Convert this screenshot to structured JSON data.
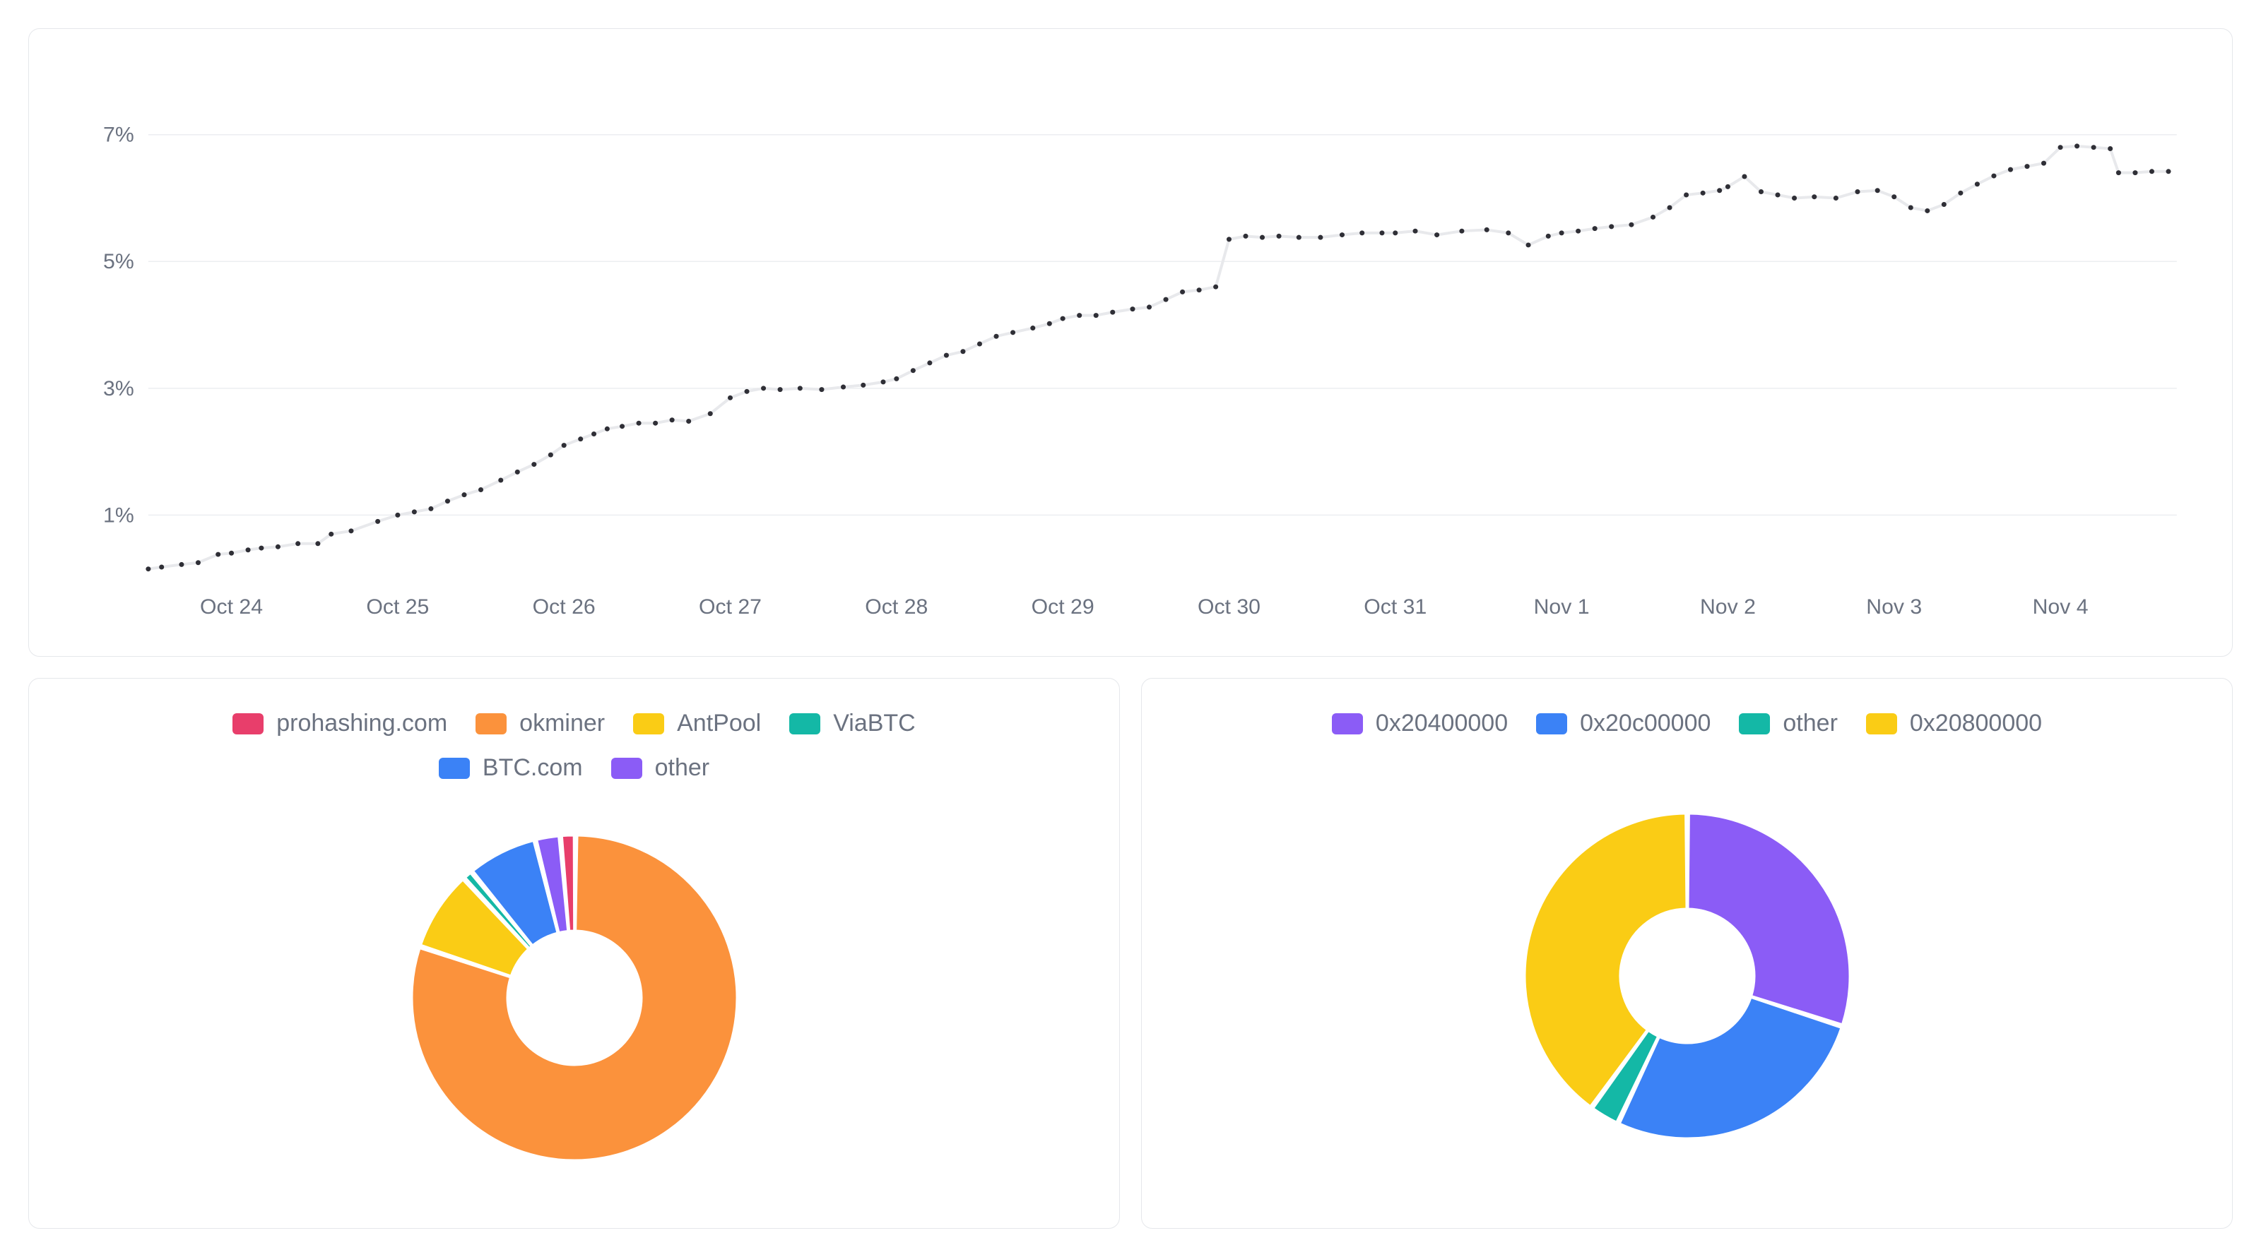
{
  "chart_data": [
    {
      "type": "line",
      "title": "",
      "xlabel": "",
      "ylabel": "",
      "ylim": [
        0,
        8
      ],
      "y_ticks": [
        1,
        3,
        5,
        7
      ],
      "y_tick_format": "%",
      "x_categories": [
        "Oct 24",
        "Oct 25",
        "Oct 26",
        "Oct 27",
        "Oct 28",
        "Oct 29",
        "Oct 30",
        "Oct 31",
        "Nov 1",
        "Nov 2",
        "Nov 3",
        "Nov 4"
      ],
      "series": [
        {
          "name": "value",
          "points": [
            [
              23.5,
              0.15
            ],
            [
              23.58,
              0.18
            ],
            [
              23.7,
              0.22
            ],
            [
              23.8,
              0.25
            ],
            [
              23.92,
              0.38
            ],
            [
              24.0,
              0.4
            ],
            [
              24.1,
              0.45
            ],
            [
              24.18,
              0.48
            ],
            [
              24.28,
              0.5
            ],
            [
              24.4,
              0.55
            ],
            [
              24.52,
              0.55
            ],
            [
              24.6,
              0.7
            ],
            [
              24.72,
              0.75
            ],
            [
              24.88,
              0.9
            ],
            [
              25.0,
              1.0
            ],
            [
              25.1,
              1.05
            ],
            [
              25.2,
              1.1
            ],
            [
              25.3,
              1.22
            ],
            [
              25.4,
              1.32
            ],
            [
              25.5,
              1.4
            ],
            [
              25.62,
              1.55
            ],
            [
              25.72,
              1.68
            ],
            [
              25.82,
              1.8
            ],
            [
              25.92,
              1.95
            ],
            [
              26.0,
              2.1
            ],
            [
              26.1,
              2.2
            ],
            [
              26.18,
              2.28
            ],
            [
              26.26,
              2.36
            ],
            [
              26.35,
              2.4
            ],
            [
              26.45,
              2.45
            ],
            [
              26.55,
              2.45
            ],
            [
              26.65,
              2.5
            ],
            [
              26.75,
              2.48
            ],
            [
              26.88,
              2.6
            ],
            [
              27.0,
              2.85
            ],
            [
              27.1,
              2.95
            ],
            [
              27.2,
              3.0
            ],
            [
              27.3,
              2.98
            ],
            [
              27.42,
              3.0
            ],
            [
              27.55,
              2.98
            ],
            [
              27.68,
              3.02
            ],
            [
              27.8,
              3.05
            ],
            [
              27.92,
              3.1
            ],
            [
              28.0,
              3.15
            ],
            [
              28.1,
              3.28
            ],
            [
              28.2,
              3.4
            ],
            [
              28.3,
              3.52
            ],
            [
              28.4,
              3.58
            ],
            [
              28.5,
              3.7
            ],
            [
              28.6,
              3.82
            ],
            [
              28.7,
              3.88
            ],
            [
              28.82,
              3.95
            ],
            [
              28.92,
              4.02
            ],
            [
              29.0,
              4.1
            ],
            [
              29.1,
              4.15
            ],
            [
              29.2,
              4.15
            ],
            [
              29.3,
              4.2
            ],
            [
              29.42,
              4.25
            ],
            [
              29.52,
              4.28
            ],
            [
              29.62,
              4.4
            ],
            [
              29.72,
              4.52
            ],
            [
              29.82,
              4.55
            ],
            [
              29.92,
              4.6
            ],
            [
              30.0,
              5.35
            ],
            [
              30.1,
              5.4
            ],
            [
              30.2,
              5.38
            ],
            [
              30.3,
              5.4
            ],
            [
              30.42,
              5.38
            ],
            [
              30.55,
              5.38
            ],
            [
              30.68,
              5.42
            ],
            [
              30.8,
              5.45
            ],
            [
              30.92,
              5.45
            ],
            [
              31.0,
              5.45
            ],
            [
              31.12,
              5.48
            ],
            [
              31.25,
              5.42
            ],
            [
              31.4,
              5.48
            ],
            [
              31.55,
              5.5
            ],
            [
              31.68,
              5.45
            ],
            [
              31.8,
              5.26
            ],
            [
              31.92,
              5.4
            ],
            [
              32.0,
              5.45
            ],
            [
              32.1,
              5.48
            ],
            [
              32.2,
              5.52
            ],
            [
              32.3,
              5.55
            ],
            [
              32.42,
              5.58
            ],
            [
              32.55,
              5.7
            ],
            [
              32.65,
              5.85
            ],
            [
              32.75,
              6.05
            ],
            [
              32.85,
              6.08
            ],
            [
              32.95,
              6.12
            ],
            [
              33.0,
              6.18
            ],
            [
              33.1,
              6.34
            ],
            [
              33.2,
              6.1
            ],
            [
              33.3,
              6.05
            ],
            [
              33.4,
              6.0
            ],
            [
              33.52,
              6.02
            ],
            [
              33.65,
              6.0
            ],
            [
              33.78,
              6.1
            ],
            [
              33.9,
              6.12
            ],
            [
              34.0,
              6.02
            ],
            [
              34.1,
              5.85
            ],
            [
              34.2,
              5.8
            ],
            [
              34.3,
              5.9
            ],
            [
              34.4,
              6.08
            ],
            [
              34.5,
              6.22
            ],
            [
              34.6,
              6.35
            ],
            [
              34.7,
              6.45
            ],
            [
              34.8,
              6.5
            ],
            [
              34.9,
              6.55
            ],
            [
              35.0,
              6.8
            ],
            [
              35.1,
              6.82
            ],
            [
              35.2,
              6.8
            ],
            [
              35.3,
              6.78
            ],
            [
              35.35,
              6.4
            ],
            [
              35.45,
              6.4
            ],
            [
              35.55,
              6.42
            ],
            [
              35.65,
              6.42
            ]
          ]
        }
      ]
    },
    {
      "type": "donut",
      "title": "",
      "series": [
        {
          "name": "prohashing.com",
          "value": 1.5,
          "color": "#e83e6b"
        },
        {
          "name": "okminer",
          "value": 80,
          "color": "#fb923c"
        },
        {
          "name": "AntPool",
          "value": 8,
          "color": "#facc15"
        },
        {
          "name": "ViaBTC",
          "value": 1,
          "color": "#14b8a6"
        },
        {
          "name": "BTC.com",
          "value": 7,
          "color": "#3b82f6"
        },
        {
          "name": "other",
          "value": 2.5,
          "color": "#8b5cf6"
        }
      ]
    },
    {
      "type": "donut",
      "title": "",
      "series": [
        {
          "name": "0x20400000",
          "value": 30,
          "color": "#8b5cf6"
        },
        {
          "name": "0x20c00000",
          "value": 27,
          "color": "#3b82f6"
        },
        {
          "name": "other",
          "value": 3,
          "color": "#14b8a6"
        },
        {
          "name": "0x20800000",
          "value": 40,
          "color": "#facc15"
        }
      ]
    }
  ]
}
